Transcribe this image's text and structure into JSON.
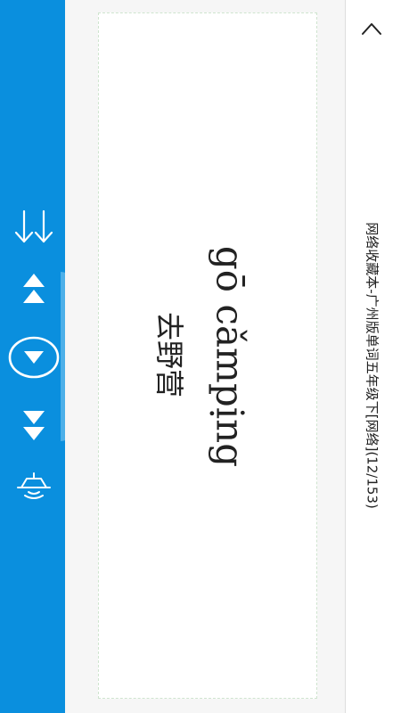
{
  "header": {
    "title": "网络收藏本-广州版单词五年级下[网络](12/153)"
  },
  "card": {
    "word": "gō cǎmpịng",
    "meaning": "去野营"
  },
  "controls": [
    {
      "name": "repeat-all-icon"
    },
    {
      "name": "double-up-icon"
    },
    {
      "name": "down-circle-icon"
    },
    {
      "name": "double-down-icon"
    },
    {
      "name": "speaker-icon"
    },
    {
      "name": "back-chevron-icon"
    }
  ],
  "colors": {
    "sidebar": "#0a8fde",
    "sidebar_tab": "#4db0e9",
    "content_bg": "#f6f6f6",
    "card_border": "#cfe4cf",
    "text": "#222222"
  }
}
